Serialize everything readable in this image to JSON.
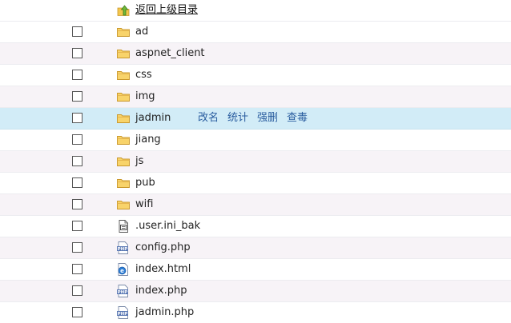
{
  "parent_link": {
    "label": "返回上级目录",
    "icon": "up-arrow-folder-icon"
  },
  "files": [
    {
      "name": "ad",
      "type": "folder"
    },
    {
      "name": "aspnet_client",
      "type": "folder"
    },
    {
      "name": "css",
      "type": "folder"
    },
    {
      "name": "img",
      "type": "folder"
    },
    {
      "name": "jadmin",
      "type": "folder",
      "hovered": true
    },
    {
      "name": "jiang",
      "type": "folder"
    },
    {
      "name": "js",
      "type": "folder"
    },
    {
      "name": "pub",
      "type": "folder"
    },
    {
      "name": "wifi",
      "type": "folder"
    },
    {
      "name": ".user.ini_bak",
      "type": "file-generic"
    },
    {
      "name": "config.php",
      "type": "file-php"
    },
    {
      "name": "index.html",
      "type": "file-html"
    },
    {
      "name": "index.php",
      "type": "file-php"
    },
    {
      "name": "jadmin.php",
      "type": "file-php"
    }
  ],
  "row_actions": {
    "rename": "改名",
    "stats": "统计",
    "force_delete": "强删",
    "view": "查毒"
  },
  "colors": {
    "row_alt": "#f7f3f7",
    "row_highlight": "#d2ecf7",
    "action_link": "#2a5d9f",
    "folder": "#f3c64d"
  }
}
